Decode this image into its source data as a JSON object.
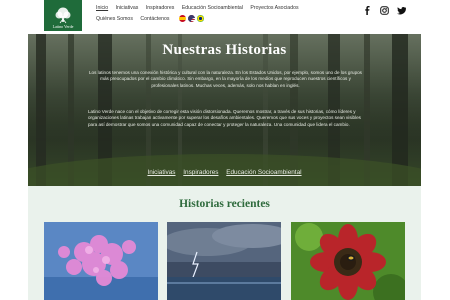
{
  "header": {
    "logo_text": "Latino Verde",
    "nav": [
      {
        "label": "Inicio",
        "active": true
      },
      {
        "label": "Iniciativas",
        "active": false
      },
      {
        "label": "Inspiradores",
        "active": false
      },
      {
        "label": "Educación Socioambiental",
        "active": false
      },
      {
        "label": "Proyectos Asociados",
        "active": false
      },
      {
        "label": "Quiénes Somos",
        "active": false
      },
      {
        "label": "Contáctenos",
        "active": false
      }
    ],
    "flags": [
      "spain-flag-icon",
      "usa-flag-icon",
      "brazil-flag-icon"
    ],
    "socials": [
      "facebook-icon",
      "instagram-icon",
      "twitter-icon"
    ]
  },
  "hero": {
    "title": "Nuestras Historias",
    "paragraph1": "Los latinos tenemos una conexión histórica y cultural con la naturaleza. En los Estados Unidos, por ejemplo, somos uno de los grupos más preocupados por el cambio climático. Sin embargo, en la mayoría de los medios que reproducen nuestros científicos y profesionales latinos. Muchas veces, además, solo nos hablan en inglés.",
    "paragraph2": "Latino Verde nace con el objetivo de corregir esta visión distorsionada. Queremos mostrar, a través de sus historias, cómo líderes y organizaciones latinas trabajan activamente por superar los desafíos ambientales. Queremos que sus voces y proyectos sean visibles para así demostrar que somos una comunidad capaz de conectar y proteger la naturaleza. Una comunidad que lidera el cambio.",
    "links": [
      "Iniciativas",
      "Inspiradores",
      "Educación Socioambiental"
    ]
  },
  "recent": {
    "title": "Historias recientes"
  },
  "colors": {
    "brand_green": "#1f6b3a",
    "title_green": "#2f6b3d",
    "section_bg": "#eaf2ec"
  }
}
